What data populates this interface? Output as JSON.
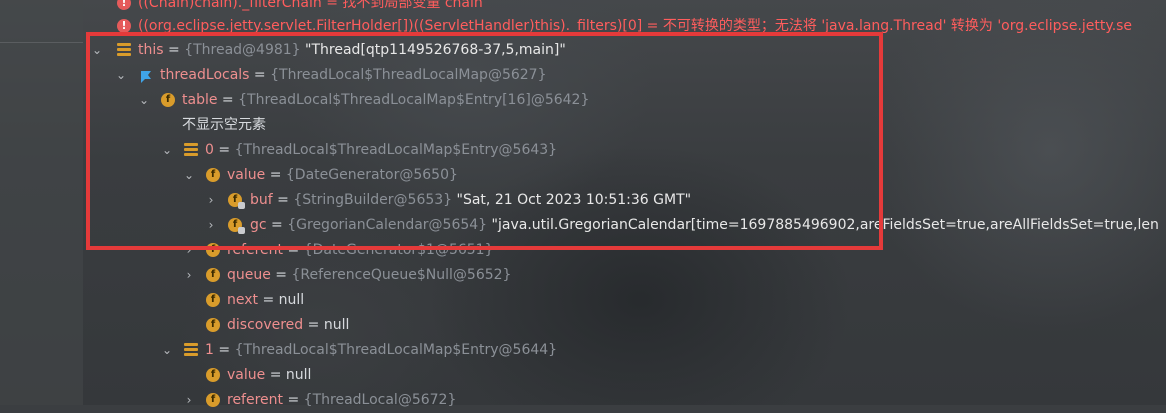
{
  "errors": [
    {
      "text": "((Chain)chain)._filterChain = 找不到局部变量 chain"
    },
    {
      "text": "((org.eclipse.jetty.servlet.FilterHolder[])((ServletHandler)this)._filters)[0] = 不可转换的类型；无法将 'java.lang.Thread' 转换为 'org.eclipse.jetty.se"
    }
  ],
  "tree": {
    "this": {
      "name": "this",
      "eq": " = ",
      "ref": "{Thread@4981} ",
      "value": "\"Thread[qtp1149526768-37,5,main]\""
    },
    "threadLocals": {
      "name": "threadLocals",
      "eq": " = ",
      "ref": "{ThreadLocal$ThreadLocalMap@5627}"
    },
    "table": {
      "name": "table",
      "eq": " = ",
      "ref": "{ThreadLocal$ThreadLocalMap$Entry[16]@5642}"
    },
    "hide_empty": "不显示空元素",
    "entry0": {
      "name": "0",
      "eq": " = ",
      "ref": "{ThreadLocal$ThreadLocalMap$Entry@5643}"
    },
    "value0": {
      "name": "value",
      "eq": " = ",
      "ref": "{DateGenerator@5650}"
    },
    "buf": {
      "name": "buf",
      "eq": " = ",
      "ref": "{StringBuilder@5653} ",
      "value": "\"Sat, 21 Oct 2023 10:51:36 GMT\""
    },
    "gc": {
      "name": "gc",
      "eq": " = ",
      "ref": "{GregorianCalendar@5654} ",
      "value": "\"java.util.GregorianCalendar[time=1697885496902,areFieldsSet=true,areAllFieldsSet=true,len"
    },
    "referent0": {
      "name": "referent",
      "eq": " = ",
      "ref": "{DateGenerator$1@5651}"
    },
    "queue": {
      "name": "queue",
      "eq": " = ",
      "ref": "{ReferenceQueue$Null@5652}"
    },
    "next": {
      "name": "next",
      "eq": " = ",
      "value": "null"
    },
    "discovered": {
      "name": "discovered",
      "eq": " = ",
      "value": "null"
    },
    "entry1": {
      "name": "1",
      "eq": " = ",
      "ref": "{ThreadLocal$ThreadLocalMap$Entry@5644}"
    },
    "value1": {
      "name": "value",
      "eq": " = ",
      "value": "null"
    },
    "referent1": {
      "name": "referent",
      "eq": " = ",
      "ref": "{ThreadLocal@5672}"
    }
  },
  "colors": {
    "highlight": "#e53a3a",
    "field_icon": "#d99c2b",
    "error": "#ff5d5d",
    "name": "#ee8f8f"
  }
}
